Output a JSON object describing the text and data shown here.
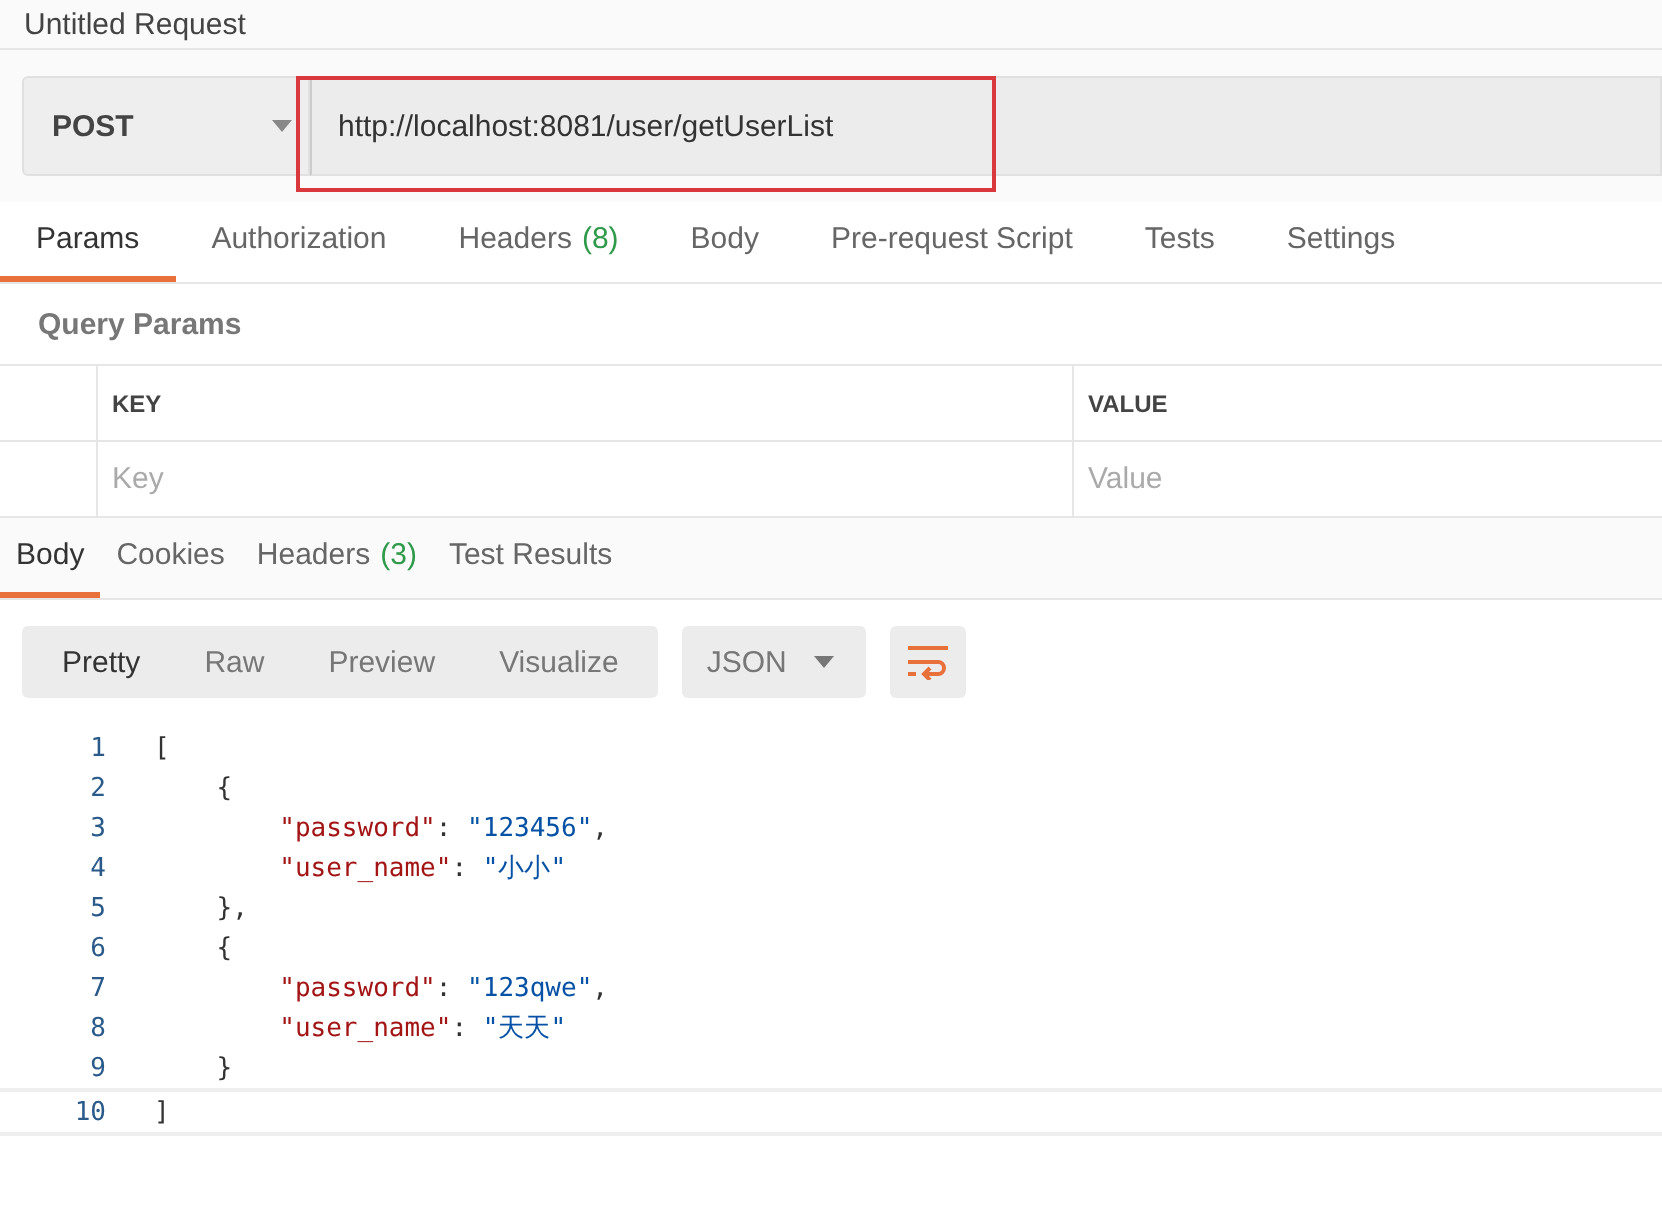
{
  "request": {
    "title": "Untitled Request",
    "method": "POST",
    "url": "http://localhost:8081/user/getUserList"
  },
  "request_tabs": [
    {
      "label": "Params",
      "selected": true
    },
    {
      "label": "Authorization",
      "selected": false
    },
    {
      "label": "Headers",
      "count": "(8)",
      "selected": false
    },
    {
      "label": "Body",
      "selected": false
    },
    {
      "label": "Pre-request Script",
      "selected": false
    },
    {
      "label": "Tests",
      "selected": false
    },
    {
      "label": "Settings",
      "selected": false
    }
  ],
  "query_params": {
    "title": "Query Params",
    "columns": [
      "KEY",
      "VALUE"
    ],
    "placeholders": [
      "Key",
      "Value"
    ]
  },
  "response_tabs": [
    {
      "label": "Body",
      "selected": true
    },
    {
      "label": "Cookies",
      "selected": false
    },
    {
      "label": "Headers",
      "count": "(3)",
      "selected": false
    },
    {
      "label": "Test Results",
      "selected": false
    }
  ],
  "view_modes": [
    {
      "label": "Pretty",
      "selected": true
    },
    {
      "label": "Raw",
      "selected": false
    },
    {
      "label": "Preview",
      "selected": false
    },
    {
      "label": "Visualize",
      "selected": false
    }
  ],
  "format": "JSON",
  "code": [
    {
      "number": "1",
      "tokens": [
        {
          "kind": "punct",
          "text": "["
        }
      ]
    },
    {
      "number": "2",
      "tokens": [
        {
          "kind": "punct",
          "text": "    {"
        }
      ]
    },
    {
      "number": "3",
      "tokens": [
        {
          "kind": "key",
          "text": "        \"password\""
        },
        {
          "kind": "punct",
          "text": ": "
        },
        {
          "kind": "string",
          "text": "\"123456\""
        },
        {
          "kind": "punct",
          "text": ","
        }
      ]
    },
    {
      "number": "4",
      "tokens": [
        {
          "kind": "key",
          "text": "        \"user_name\""
        },
        {
          "kind": "punct",
          "text": ": "
        },
        {
          "kind": "string",
          "text": "\"小小\""
        }
      ]
    },
    {
      "number": "5",
      "tokens": [
        {
          "kind": "punct",
          "text": "    },"
        }
      ]
    },
    {
      "number": "6",
      "tokens": [
        {
          "kind": "punct",
          "text": "    {"
        }
      ]
    },
    {
      "number": "7",
      "tokens": [
        {
          "kind": "key",
          "text": "        \"password\""
        },
        {
          "kind": "punct",
          "text": ": "
        },
        {
          "kind": "string",
          "text": "\"123qwe\""
        },
        {
          "kind": "punct",
          "text": ","
        }
      ]
    },
    {
      "number": "8",
      "tokens": [
        {
          "kind": "key",
          "text": "        \"user_name\""
        },
        {
          "kind": "punct",
          "text": ": "
        },
        {
          "kind": "string",
          "text": "\"天天\""
        }
      ]
    },
    {
      "number": "9",
      "tokens": [
        {
          "kind": "punct",
          "text": "    }"
        }
      ]
    },
    {
      "number": "10",
      "tokens": [
        {
          "kind": "punct",
          "text": "]"
        }
      ]
    }
  ]
}
